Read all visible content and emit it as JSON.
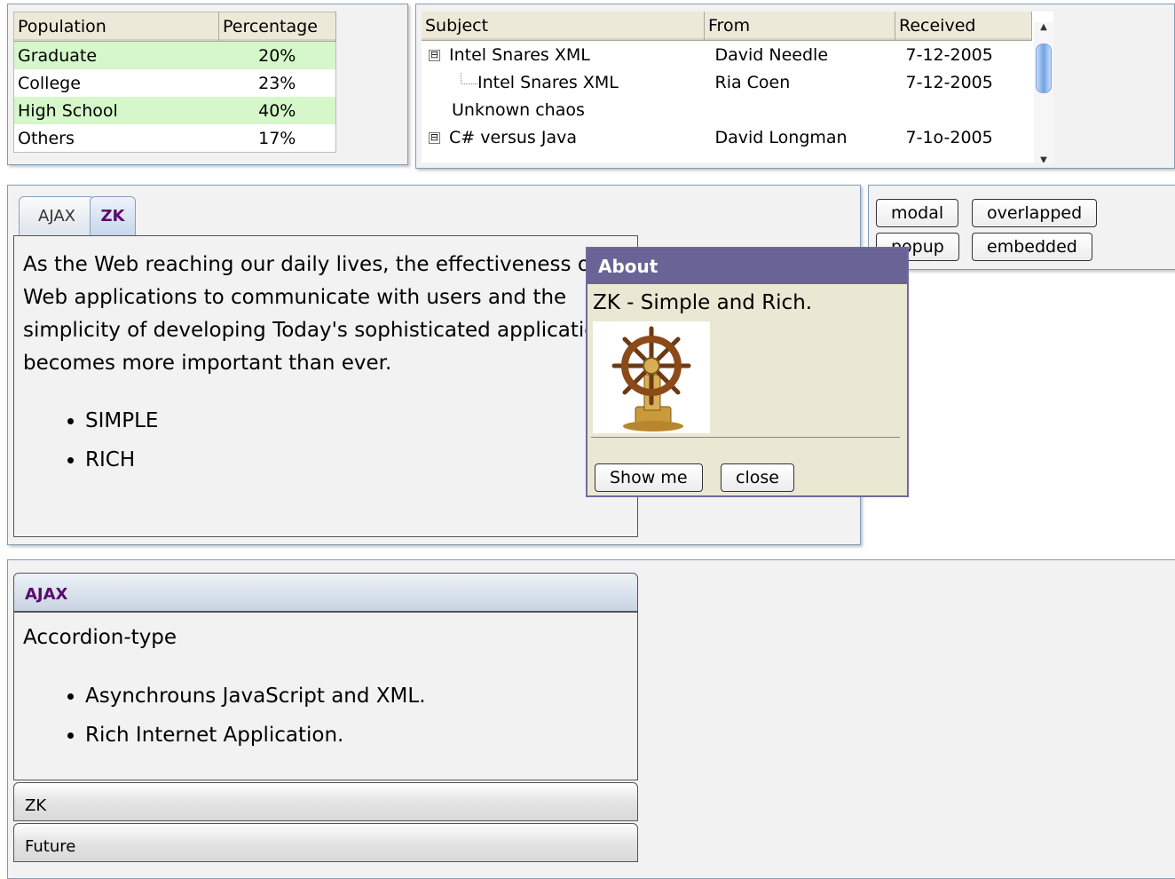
{
  "population_grid": {
    "headers": [
      "Population",
      "Percentage"
    ],
    "rows": [
      {
        "label": "Graduate",
        "pct": "20%"
      },
      {
        "label": "College",
        "pct": "23%"
      },
      {
        "label": "High School",
        "pct": "40%"
      },
      {
        "label": "Others",
        "pct": "17%"
      }
    ]
  },
  "mail_tree": {
    "headers": [
      "Subject",
      "From",
      "Received"
    ],
    "rows": [
      {
        "subject": "Intel Snares XML",
        "from": "David Needle",
        "received": "7-12-2005"
      },
      {
        "subject": "Intel Snares XML",
        "from": "Ria Coen",
        "received": "7-12-2005"
      },
      {
        "subject": "Unknown chaos",
        "from": "",
        "received": ""
      },
      {
        "subject": "C# versus Java",
        "from": "David Longman",
        "received": "7-1o-2005"
      }
    ],
    "toggle_glyph": "⊟"
  },
  "tabbox": {
    "tabs": [
      "AJAX",
      "ZK"
    ],
    "selected": "ZK",
    "paragraph": "As the Web reaching our daily lives, the effectiveness of Web applications to communicate with users and the simplicity of developing Today's sophisticated applications becomes more important than ever.",
    "bullets": [
      "SIMPLE",
      "RICH"
    ]
  },
  "window_modes": {
    "buttons": [
      "modal",
      "overlapped",
      "popup",
      "embedded"
    ]
  },
  "about_window": {
    "title": "About",
    "text": "ZK - Simple and Rich.",
    "image": "ship-wheel-image",
    "buttons": [
      "Show me",
      "close"
    ]
  },
  "accordion": {
    "panels": [
      "AJAX",
      "ZK",
      "Future"
    ],
    "open_panel": "AJAX",
    "heading": "Accordion-type",
    "bullets": [
      "Asynchrouns JavaScript and XML.",
      "Rich Internet Application."
    ]
  }
}
